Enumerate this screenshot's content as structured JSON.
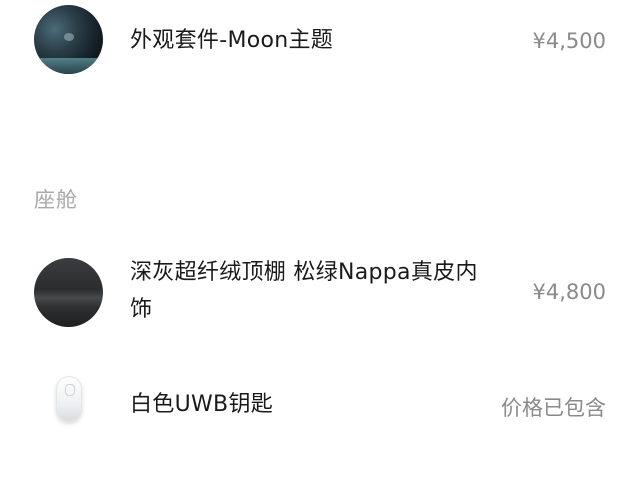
{
  "items": [
    {
      "title": "外观套件-Moon主题",
      "price": "¥4,500",
      "thumb": "moon-theme-exterior-image"
    },
    {
      "title_line1": "深灰超纤绒顶棚 松绿Nappa真皮内",
      "title_line2": "饰",
      "price": "¥4,800",
      "thumb": "interior-headliner-image"
    },
    {
      "title": "白色UWB钥匙",
      "price": "价格已包含",
      "thumb": "uwb-key-image"
    }
  ],
  "sections": {
    "cabin_label": "座舱"
  },
  "colors": {
    "text": "#1a1a1a",
    "price": "#8a8a8a",
    "section_label": "#a8a8a8",
    "background": "#ffffff"
  }
}
